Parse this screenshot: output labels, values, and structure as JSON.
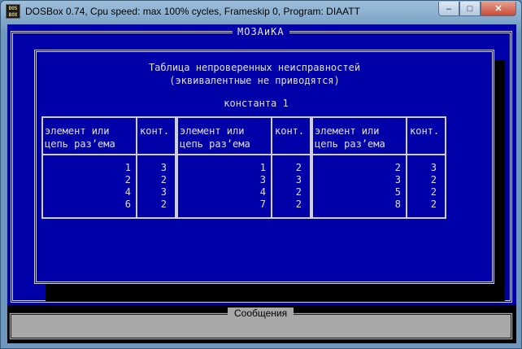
{
  "window": {
    "title": "DOSBox 0.74, Cpu speed: max 100% cycles, Frameskip  0, Program:   DIAATT",
    "icon_text": "DOS BOX",
    "minimize_label": "–",
    "maximize_label": "□",
    "close_label": "✕"
  },
  "app": {
    "frame_title": "МОЗАиКА",
    "heading_line1": "Таблица непроверенных неисправностей",
    "heading_line2": "(эквивалентные не приводятся)",
    "constant_label": "константа 1",
    "col_element_header": "элемент или\nцепь раз’ема",
    "col_contact_header": "конт.",
    "tables": [
      {
        "elements": "1\n2\n4\n6",
        "contacts": "3\n2\n3\n2"
      },
      {
        "elements": "1\n3\n4\n7",
        "contacts": "2\n3\n2\n2"
      },
      {
        "elements": "2\n3\n5\n8",
        "contacts": "3\n2\n2\n2"
      }
    ],
    "messages_title": "Сообщения"
  },
  "colors": {
    "dos_background": "#0000a8",
    "dos_text": "#d8d8d8",
    "message_bar": "#a8a8a8"
  }
}
